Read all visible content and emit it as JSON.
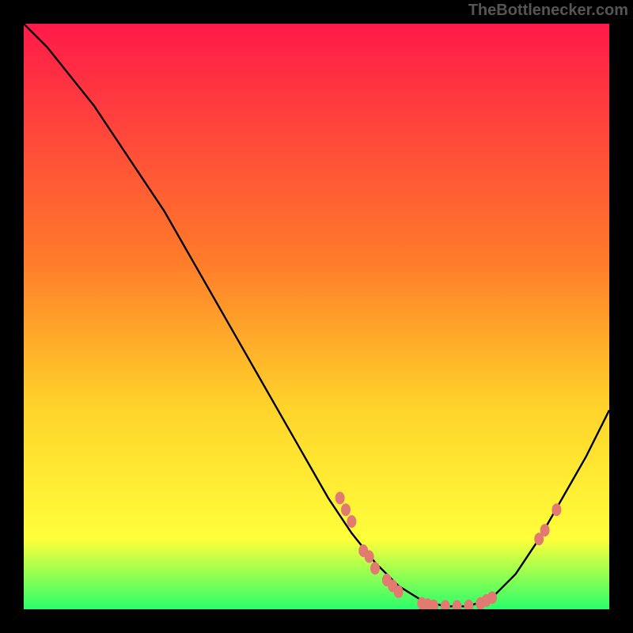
{
  "watermark": "TheBottlenecker.com",
  "colors": {
    "grad_top": "#ff1a4a",
    "grad_mid1": "#ff7a2a",
    "grad_mid2": "#ffd22a",
    "grad_mid3": "#ffff3a",
    "grad_bot": "#2aff6a",
    "curve": "#000000",
    "marker": "#e27a72",
    "black": "#000000"
  },
  "chart_data": {
    "type": "line",
    "title": "",
    "xlabel": "",
    "ylabel": "",
    "xlim": [
      0,
      100
    ],
    "ylim": [
      0,
      100
    ],
    "curve": {
      "x": [
        0,
        4,
        8,
        12,
        16,
        20,
        24,
        28,
        32,
        36,
        40,
        44,
        48,
        52,
        56,
        60,
        64,
        68,
        72,
        76,
        80,
        84,
        88,
        92,
        96,
        100
      ],
      "y": [
        100,
        96,
        91,
        86,
        80,
        74,
        68,
        61,
        54,
        47,
        40,
        33,
        26,
        19,
        13,
        8,
        4,
        1.5,
        0.5,
        0.5,
        2,
        6,
        12,
        19,
        26,
        34
      ]
    },
    "markers": [
      {
        "x": 54,
        "y": 19
      },
      {
        "x": 55,
        "y": 17
      },
      {
        "x": 56,
        "y": 15
      },
      {
        "x": 58,
        "y": 10
      },
      {
        "x": 59,
        "y": 9
      },
      {
        "x": 60,
        "y": 7
      },
      {
        "x": 62,
        "y": 5
      },
      {
        "x": 63,
        "y": 4
      },
      {
        "x": 64,
        "y": 3
      },
      {
        "x": 68,
        "y": 1
      },
      {
        "x": 69,
        "y": 0.8
      },
      {
        "x": 70,
        "y": 0.6
      },
      {
        "x": 72,
        "y": 0.5
      },
      {
        "x": 74,
        "y": 0.5
      },
      {
        "x": 76,
        "y": 0.6
      },
      {
        "x": 78,
        "y": 1
      },
      {
        "x": 79,
        "y": 1.5
      },
      {
        "x": 80,
        "y": 2
      },
      {
        "x": 88,
        "y": 12
      },
      {
        "x": 89,
        "y": 13.5
      },
      {
        "x": 91,
        "y": 17
      }
    ]
  }
}
